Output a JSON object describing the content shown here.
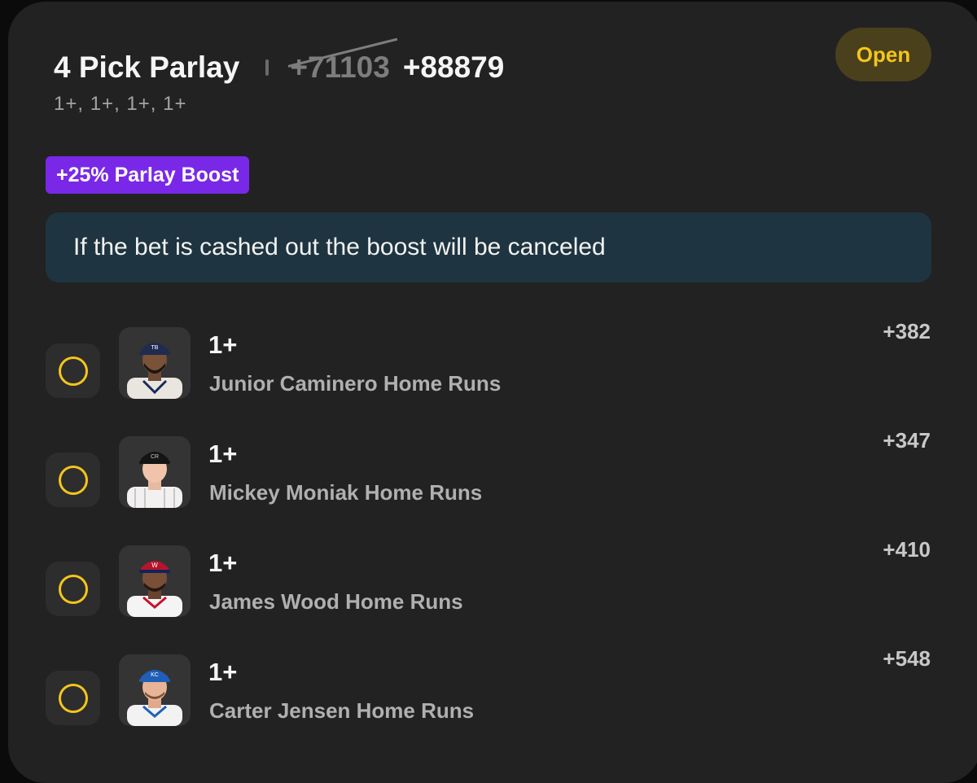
{
  "header": {
    "title": "4 Pick Parlay",
    "old_odds": "+71103",
    "new_odds": "+88879",
    "subtitle": "1+, 1+, 1+, 1+",
    "status": "Open"
  },
  "boost": {
    "label": "+25% Parlay Boost",
    "notice": "If the bet is cashed out the boost will be canceled"
  },
  "legs": [
    {
      "line": "1+",
      "market": "Junior Caminero Home Runs",
      "odds": "+382",
      "cap_logo": "TB"
    },
    {
      "line": "1+",
      "market": "Mickey Moniak Home Runs",
      "odds": "+347",
      "cap_logo": "CR"
    },
    {
      "line": "1+",
      "market": "James Wood Home Runs",
      "odds": "+410",
      "cap_logo": "W"
    },
    {
      "line": "1+",
      "market": "Carter Jensen Home Runs",
      "odds": "+548",
      "cap_logo": "KC"
    }
  ],
  "colors": {
    "card_bg": "#222223",
    "accent_yellow": "#f3c51d",
    "boost_purple": "#7a28e8",
    "notice_bg": "#1e3440"
  }
}
